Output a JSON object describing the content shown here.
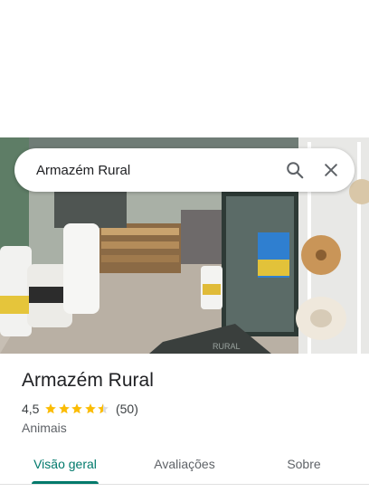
{
  "search": {
    "query": "Armazém Rural",
    "search_icon": "search-icon",
    "close_icon": "close-icon"
  },
  "hero": {
    "mat_text": "RURAL"
  },
  "place": {
    "name": "Armazém Rural",
    "rating": "4,5",
    "stars_filled": 4.5,
    "reviews": "(50)",
    "category": "Animais"
  },
  "tabs": [
    {
      "label": "Visão geral",
      "active": true
    },
    {
      "label": "Avaliações",
      "active": false
    },
    {
      "label": "Sobre",
      "active": false
    }
  ],
  "colors": {
    "accent": "#00796b",
    "star": "#fbbc04",
    "star_empty": "#dadce0"
  }
}
